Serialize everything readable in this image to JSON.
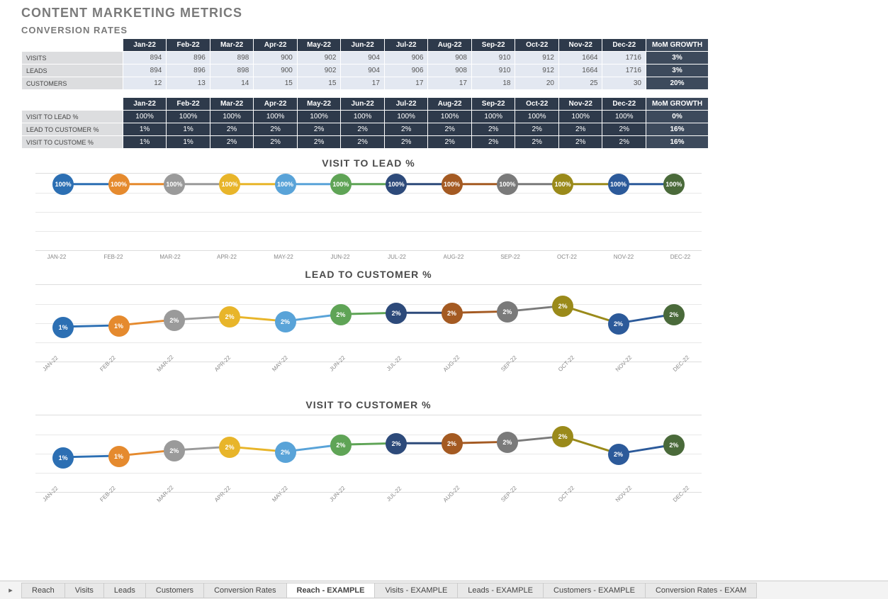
{
  "header": {
    "title": "CONTENT MARKETING METRICS",
    "subtitle": "CONVERSION RATES"
  },
  "months": [
    "Jan-22",
    "Feb-22",
    "Mar-22",
    "Apr-22",
    "May-22",
    "Jun-22",
    "Jul-22",
    "Aug-22",
    "Sep-22",
    "Oct-22",
    "Nov-22",
    "Dec-22"
  ],
  "growth_label": "MoM GROWTH",
  "table1": {
    "rows": [
      {
        "label": "VISITS",
        "vals": [
          "894",
          "896",
          "898",
          "900",
          "902",
          "904",
          "906",
          "908",
          "910",
          "912",
          "1664",
          "1716"
        ],
        "growth": "3%"
      },
      {
        "label": "LEADS",
        "vals": [
          "894",
          "896",
          "898",
          "900",
          "902",
          "904",
          "906",
          "908",
          "910",
          "912",
          "1664",
          "1716"
        ],
        "growth": "3%"
      },
      {
        "label": "CUSTOMERS",
        "vals": [
          "12",
          "13",
          "14",
          "15",
          "15",
          "17",
          "17",
          "17",
          "18",
          "20",
          "25",
          "30"
        ],
        "growth": "20%"
      }
    ]
  },
  "table2": {
    "rows": [
      {
        "label": "VISIT TO LEAD %",
        "vals": [
          "100%",
          "100%",
          "100%",
          "100%",
          "100%",
          "100%",
          "100%",
          "100%",
          "100%",
          "100%",
          "100%",
          "100%"
        ],
        "growth": "0%"
      },
      {
        "label": "LEAD TO CUSTOMER %",
        "vals": [
          "1%",
          "1%",
          "2%",
          "2%",
          "2%",
          "2%",
          "2%",
          "2%",
          "2%",
          "2%",
          "2%",
          "2%"
        ],
        "growth": "16%"
      },
      {
        "label": "VISIT TO CUSTOME %",
        "vals": [
          "1%",
          "1%",
          "2%",
          "2%",
          "2%",
          "2%",
          "2%",
          "2%",
          "2%",
          "2%",
          "2%",
          "2%"
        ],
        "growth": "16%"
      }
    ]
  },
  "chart_data": [
    {
      "type": "line",
      "title": "VISIT TO LEAD %",
      "categories": [
        "JAN-22",
        "FEB-22",
        "MAR-22",
        "APR-22",
        "MAY-22",
        "JUN-22",
        "JUL-22",
        "AUG-22",
        "SEP-22",
        "OCT-22",
        "NOV-22",
        "DEC-22"
      ],
      "values": [
        100,
        100,
        100,
        100,
        100,
        100,
        100,
        100,
        100,
        100,
        100,
        100
      ],
      "labels": [
        "100%",
        "100%",
        "100%",
        "100%",
        "100%",
        "100%",
        "100%",
        "100%",
        "100%",
        "100%",
        "100%",
        "100%"
      ],
      "ylim": [
        0,
        100
      ],
      "yfix": 15,
      "rot": false
    },
    {
      "type": "line",
      "title": "LEAD TO CUSTOMER %",
      "categories": [
        "JAN-22",
        "FEB-22",
        "MAR-22",
        "APR-22",
        "MAY-22",
        "JUN-22",
        "JUL-22",
        "AUG-22",
        "SEP-22",
        "OCT-22",
        "NOV-22",
        "DEC-22"
      ],
      "values": [
        1,
        1,
        2,
        2,
        2,
        2,
        2,
        2,
        2,
        2,
        2,
        2
      ],
      "labels": [
        "1%",
        "1%",
        "2%",
        "2%",
        "2%",
        "2%",
        "2%",
        "2%",
        "2%",
        "2%",
        "2%",
        "2%"
      ],
      "ylim": [
        0,
        3
      ],
      "rot": true,
      "yoffsets": [
        60,
        58,
        50,
        45,
        52,
        42,
        40,
        40,
        38,
        30,
        55,
        42
      ]
    },
    {
      "type": "line",
      "title": "VISIT TO CUSTOMER %",
      "categories": [
        "JAN-22",
        "FEB-22",
        "MAR-22",
        "APR-22",
        "MAY-22",
        "JUN-22",
        "JUL-22",
        "AUG-22",
        "SEP-22",
        "OCT-22",
        "NOV-22",
        "DEC-22"
      ],
      "values": [
        1,
        1,
        2,
        2,
        2,
        2,
        2,
        2,
        2,
        2,
        2,
        2
      ],
      "labels": [
        "1%",
        "1%",
        "2%",
        "2%",
        "2%",
        "2%",
        "2%",
        "2%",
        "2%",
        "2%",
        "2%",
        "2%"
      ],
      "ylim": [
        0,
        3
      ],
      "rot": true,
      "yoffsets": [
        60,
        58,
        50,
        45,
        52,
        42,
        40,
        40,
        38,
        30,
        55,
        42
      ]
    }
  ],
  "colors": [
    "#2c6fb3",
    "#e58a2e",
    "#9a9a9a",
    "#e8b52a",
    "#59a3d8",
    "#5fa456",
    "#2d4a7a",
    "#a45a22",
    "#7a7a7a",
    "#9a8a1a",
    "#2c5a9a",
    "#4a6a3a"
  ],
  "tabs": [
    "Reach",
    "Visits",
    "Leads",
    "Customers",
    "Conversion Rates",
    "Reach - EXAMPLE",
    "Visits - EXAMPLE",
    "Leads - EXAMPLE",
    "Customers - EXAMPLE",
    "Conversion Rates - EXAM"
  ],
  "active_tab": 5
}
